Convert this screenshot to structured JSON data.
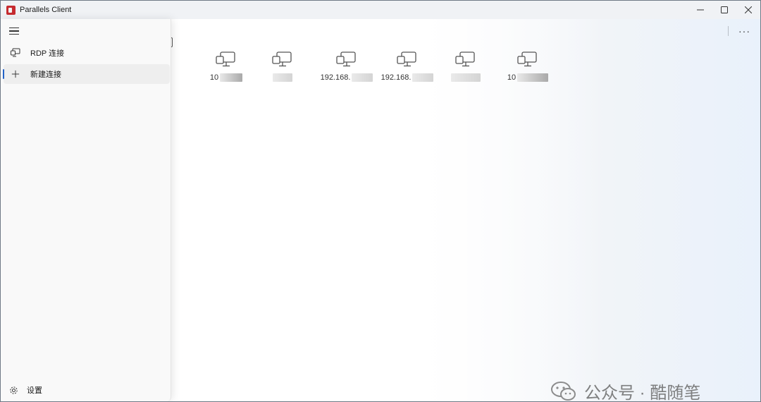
{
  "window": {
    "title": "Parallels Client",
    "controls": [
      "minimize",
      "maximize",
      "close"
    ]
  },
  "toolbar": {
    "more_label": "···"
  },
  "sidebar": {
    "menu_icon": "hamburger-icon",
    "items": [
      {
        "label": "RDP 连接",
        "icon": "rdp-connection-icon",
        "active": false
      },
      {
        "label": "新建连接",
        "icon": "plus-icon",
        "active": true
      }
    ],
    "settings": {
      "label": "设置",
      "icon": "gear-icon"
    }
  },
  "connections": [
    {
      "label_visible": "10",
      "icon": "monitor-icon"
    },
    {
      "label_visible": "",
      "icon": "monitor-icon"
    },
    {
      "label_visible": "192.168.",
      "icon": "monitor-icon"
    },
    {
      "label_visible": "192.168.",
      "icon": "monitor-icon"
    },
    {
      "label_visible": "",
      "icon": "monitor-icon"
    },
    {
      "label_visible": "10",
      "icon": "monitor-icon"
    }
  ],
  "watermark": {
    "text": "公众号 · 酷随笔"
  },
  "colors": {
    "accent": "#2463c7",
    "app_icon": "#c62b30"
  }
}
